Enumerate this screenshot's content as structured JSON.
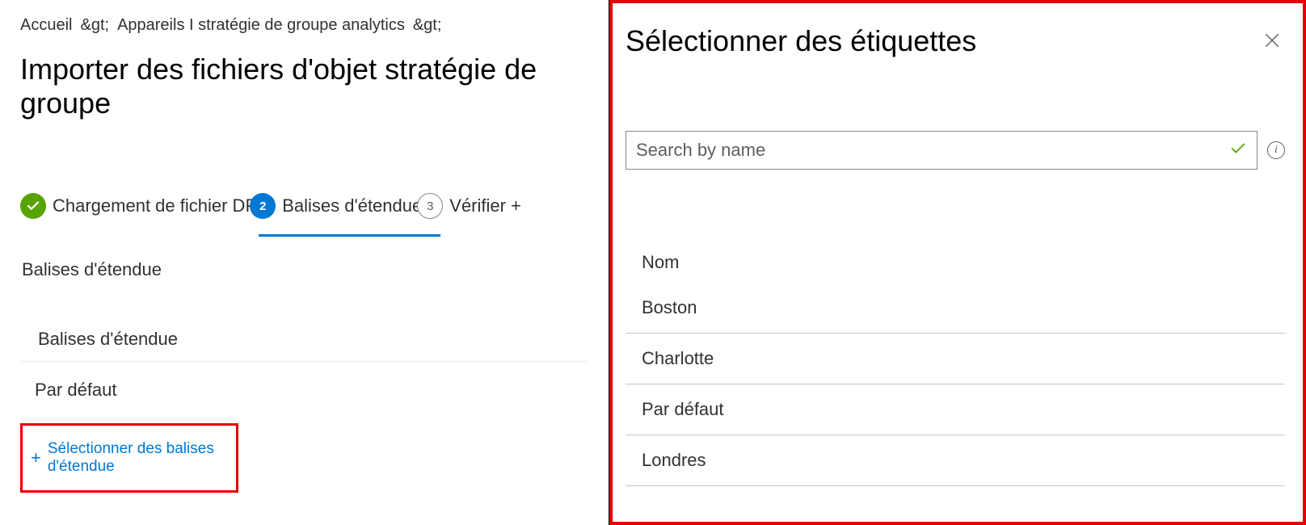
{
  "breadcrumb": {
    "home": "Accueil",
    "sep": "&gt;",
    "second": "Appareils I stratégie de groupe analytics",
    "sep2": "&gt;"
  },
  "page": {
    "title": "Importer des fichiers d'objet stratégie de groupe"
  },
  "stepper": {
    "step1": {
      "label": "Chargement de fichier DPO"
    },
    "step2": {
      "label": "Balises d'étendue",
      "num": "2"
    },
    "step3": {
      "label": "Vérifier +",
      "num": "3"
    }
  },
  "section": {
    "label": "Balises d'étendue",
    "col_header": "Balises d'étendue",
    "default_row": "Par défaut"
  },
  "add_link": {
    "label": "Sélectionner des balises d'étendue"
  },
  "flyout": {
    "title": "Sélectionner des étiquettes",
    "search_placeholder": "Search by name",
    "list_header": "Nom",
    "items": [
      "Boston",
      "Charlotte",
      "Par défaut",
      "Londres"
    ]
  }
}
